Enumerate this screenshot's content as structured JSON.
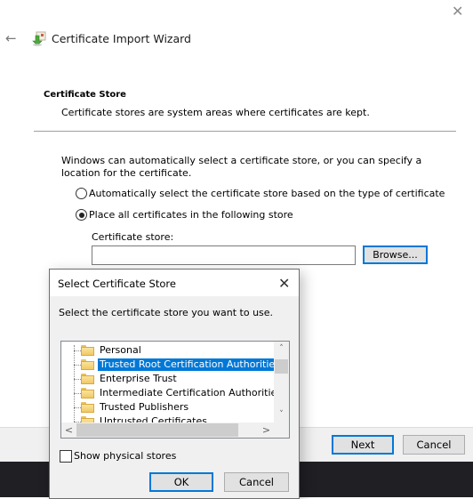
{
  "window": {
    "title": "Certificate Import Wizard",
    "back_icon": "arrow-left-icon",
    "close_icon": "close-icon",
    "app_icon": "certificate-import-icon"
  },
  "section": {
    "title": "Certificate Store",
    "subtitle": "Certificate stores are system areas where certificates are kept."
  },
  "body": {
    "intro": "Windows can automatically select a certificate store, or you can specify a location for the certificate.",
    "options": [
      {
        "label": "Automatically select the certificate store based on the type of certificate",
        "selected": false
      },
      {
        "label": "Place all certificates in the following store",
        "selected": true
      }
    ],
    "store_label": "Certificate store:",
    "store_value": "",
    "browse_label": "Browse..."
  },
  "footer": {
    "next_label": "Next",
    "cancel_label": "Cancel"
  },
  "dialog": {
    "title": "Select Certificate Store",
    "prompt": "Select the certificate store you want to use.",
    "stores": [
      {
        "label": "Personal",
        "selected": false
      },
      {
        "label": "Trusted Root Certification Authorities",
        "selected": true
      },
      {
        "label": "Enterprise Trust",
        "selected": false
      },
      {
        "label": "Intermediate Certification Authorities",
        "selected": false
      },
      {
        "label": "Trusted Publishers",
        "selected": false
      },
      {
        "label": "Untrusted Certificates",
        "selected": false
      }
    ],
    "show_physical_label": "Show physical stores",
    "show_physical_checked": false,
    "ok_label": "OK",
    "cancel_label": "Cancel",
    "scroll_up": "˄",
    "scroll_down": "˅",
    "scroll_left": "<",
    "scroll_right": ">"
  }
}
